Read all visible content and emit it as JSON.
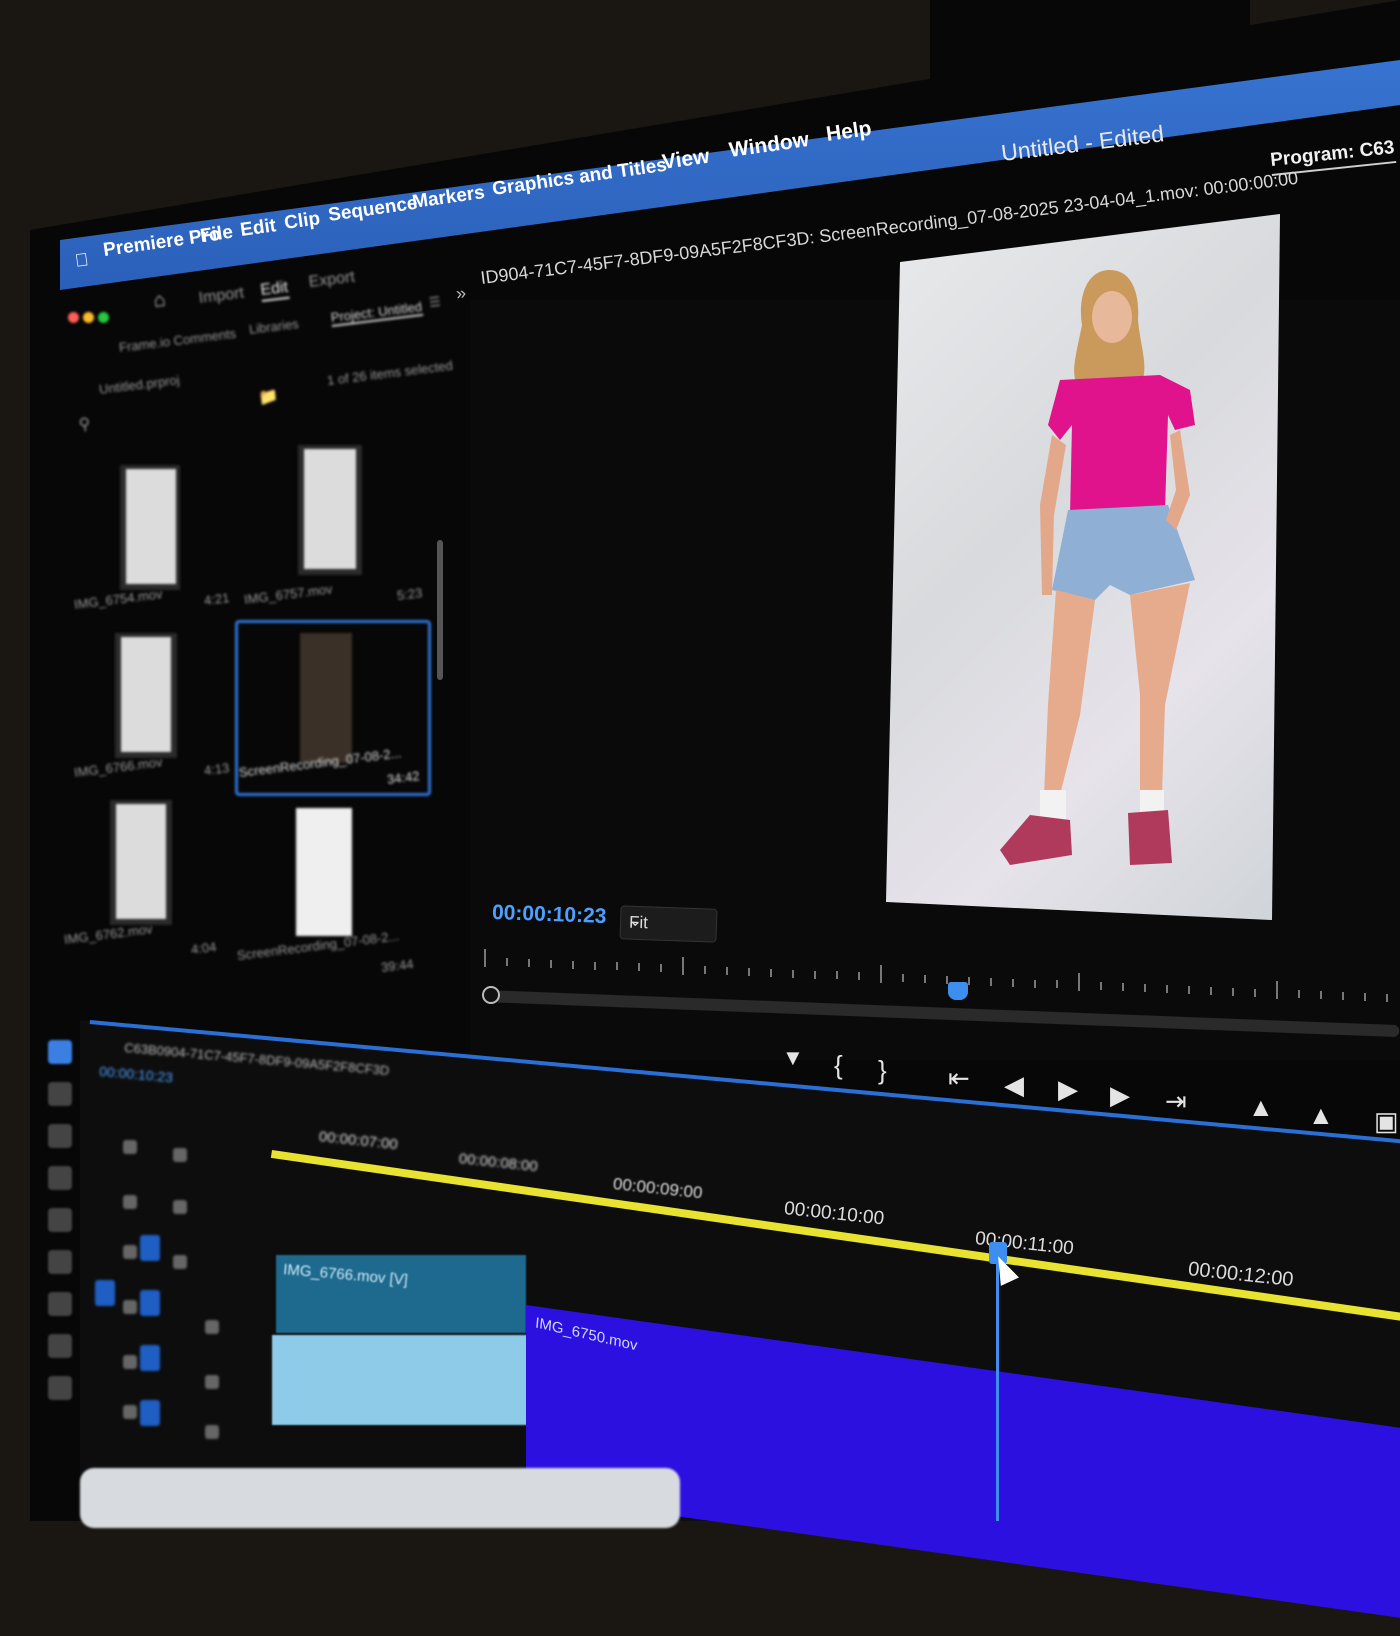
{
  "menubar": {
    "app_name": "Premiere Pro",
    "items": [
      "File",
      "Edit",
      "Clip",
      "Sequence",
      "Markers",
      "Graphics and Titles",
      "View",
      "Window",
      "Help"
    ]
  },
  "window": {
    "title": "Untitled - Edited"
  },
  "workspace_tabs": [
    "Import",
    "Edit",
    "Export"
  ],
  "program_monitor": {
    "tab_label": "Program: C63",
    "clip_label": "ID904-71C7-45F7-8DF9-09A5F2F8CF3D: ScreenRecording_07-08-2025 23-04-04_1.mov: 00:00:00:00",
    "current_time": "00:00:10:23",
    "zoom": "Fit"
  },
  "project_panel": {
    "tab_label": "Project: Untitled",
    "sub_tabs": [
      "Frame.io Comments",
      "Libraries"
    ],
    "file": "Untitled.prproj",
    "selection_info": "1 of 26 items selected",
    "items": [
      {
        "name": "IMG_6754.mov",
        "duration": "4:21"
      },
      {
        "name": "IMG_6757.mov",
        "duration": "5:23"
      },
      {
        "name": "IMG_6766.mov",
        "duration": "4:13"
      },
      {
        "name": "ScreenRecording_07-08-2...",
        "duration": "34:42"
      },
      {
        "name": "IMG_6762.mov",
        "duration": "4:04"
      },
      {
        "name": "ScreenRecording_07-08-2...",
        "duration": "39:44"
      }
    ]
  },
  "timeline": {
    "sequence_name": "C63B0904-71C7-45F7-8DF9-09A5F2F8CF3D",
    "current_time": "00:00:10:23",
    "ruler_labels": [
      "00:00:07:00",
      "00:00:08:00",
      "00:00:09:00",
      "00:00:10:00",
      "00:00:11:00",
      "00:00:12:00"
    ],
    "clips": {
      "video": "IMG_6766.mov [V]",
      "purple": "IMG_6750.mov"
    }
  },
  "colors": {
    "accent": "#2f74d8",
    "timecode": "#4da0ff",
    "work_area": "#e8e231",
    "clip_purple": "#2b10e0",
    "clip_teal": "#1e6a8f"
  }
}
